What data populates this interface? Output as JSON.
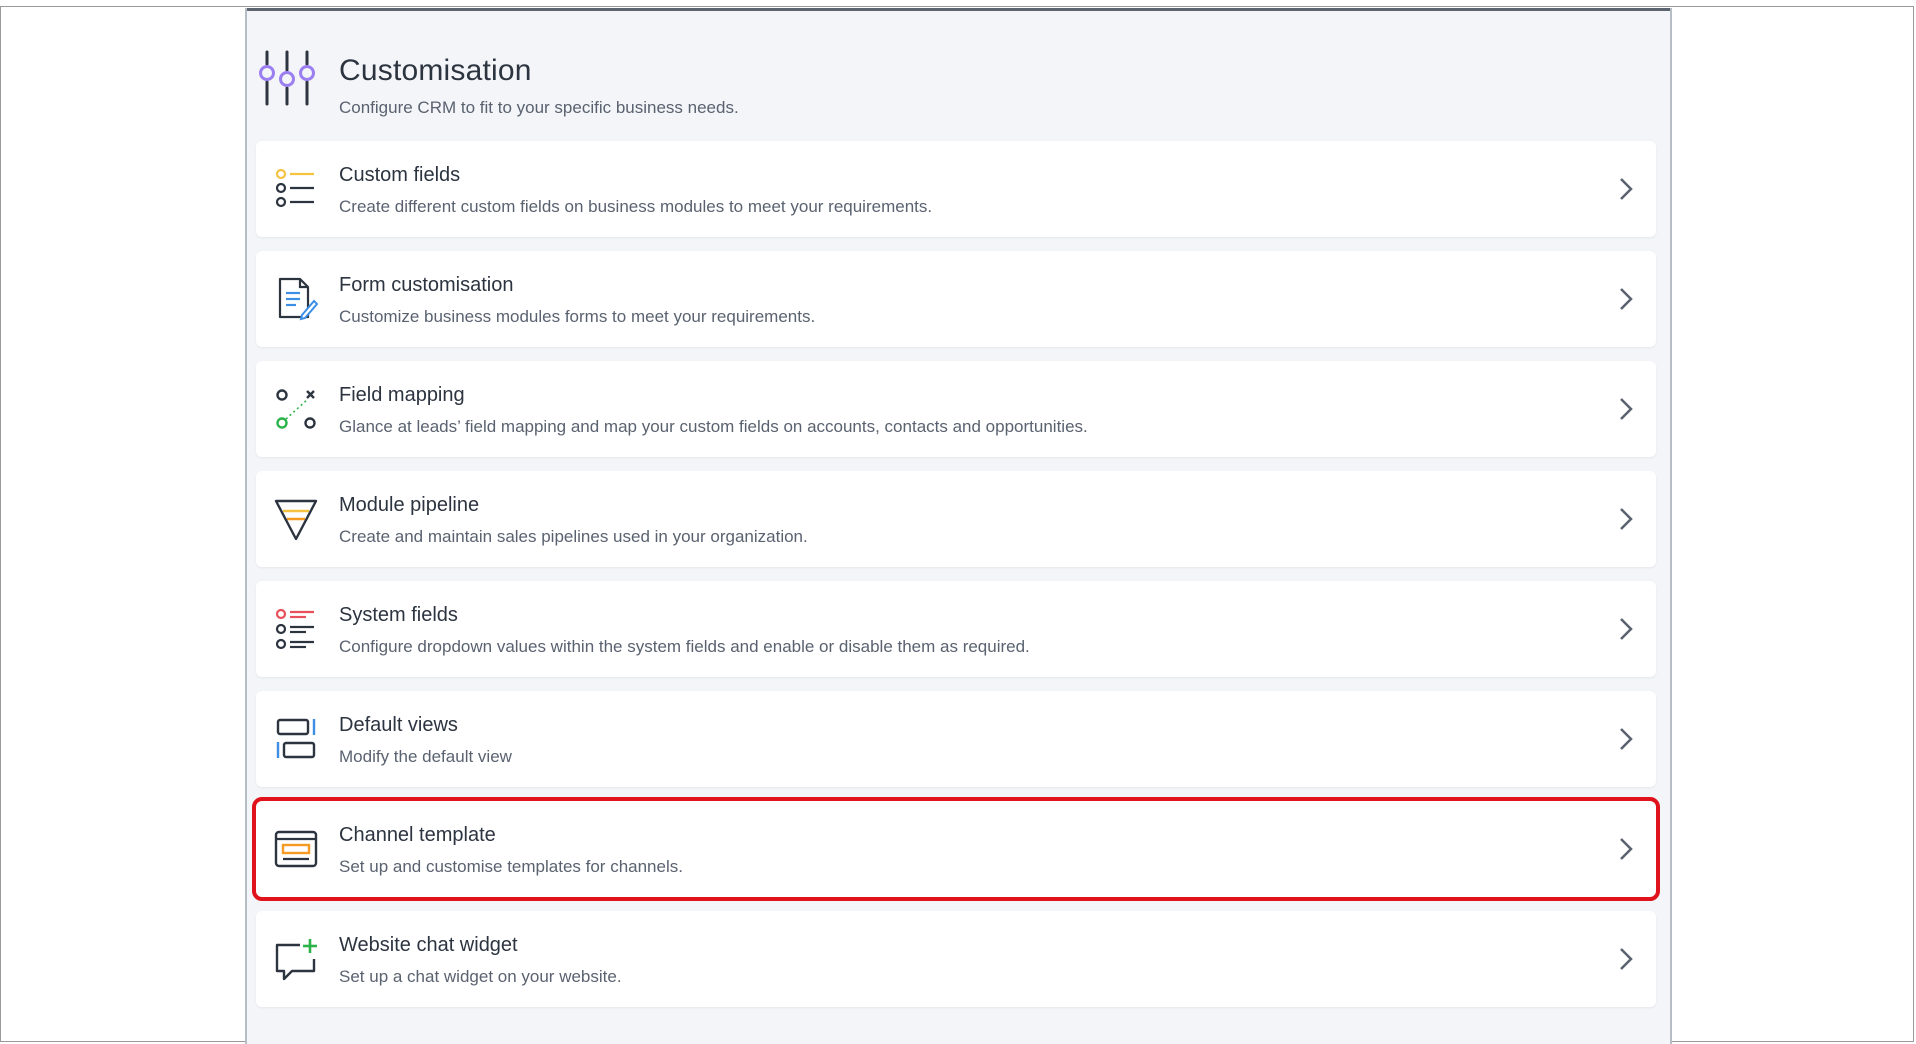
{
  "header": {
    "title": "Customisation",
    "subtitle": "Configure CRM to fit to your specific business needs.",
    "icon": "sliders-icon"
  },
  "items": [
    {
      "title": "Custom fields",
      "description": "Create different custom fields on business modules to meet your requirements.",
      "icon": "custom-fields-list-icon"
    },
    {
      "title": "Form customisation",
      "description": "Customize business modules forms to meet your requirements.",
      "icon": "form-edit-icon"
    },
    {
      "title": "Field mapping",
      "description": "Glance at leads’ field mapping and map your custom fields on accounts, contacts and opportunities.",
      "icon": "field-mapping-icon"
    },
    {
      "title": "Module pipeline",
      "description": "Create and maintain sales pipelines used in your organization.",
      "icon": "funnel-icon"
    },
    {
      "title": "System fields",
      "description": "Configure dropdown values within the system fields and enable or disable them as required.",
      "icon": "system-fields-list-icon"
    },
    {
      "title": "Default views",
      "description": "Modify the default view",
      "icon": "layout-views-icon"
    },
    {
      "title": "Channel template",
      "description": "Set up and customise templates for channels.",
      "icon": "template-icon",
      "highlighted": true
    },
    {
      "title": "Website chat widget",
      "description": "Set up a chat widget on your website.",
      "icon": "chat-add-icon"
    }
  ],
  "colors": {
    "highlight": "#e0121b",
    "accent_purple": "#9b7ff0",
    "accent_yellow": "#f5c242",
    "accent_green": "#2bb34a",
    "accent_red": "#e8505b",
    "accent_blue": "#3d8fe6",
    "accent_orange": "#f59a23"
  }
}
